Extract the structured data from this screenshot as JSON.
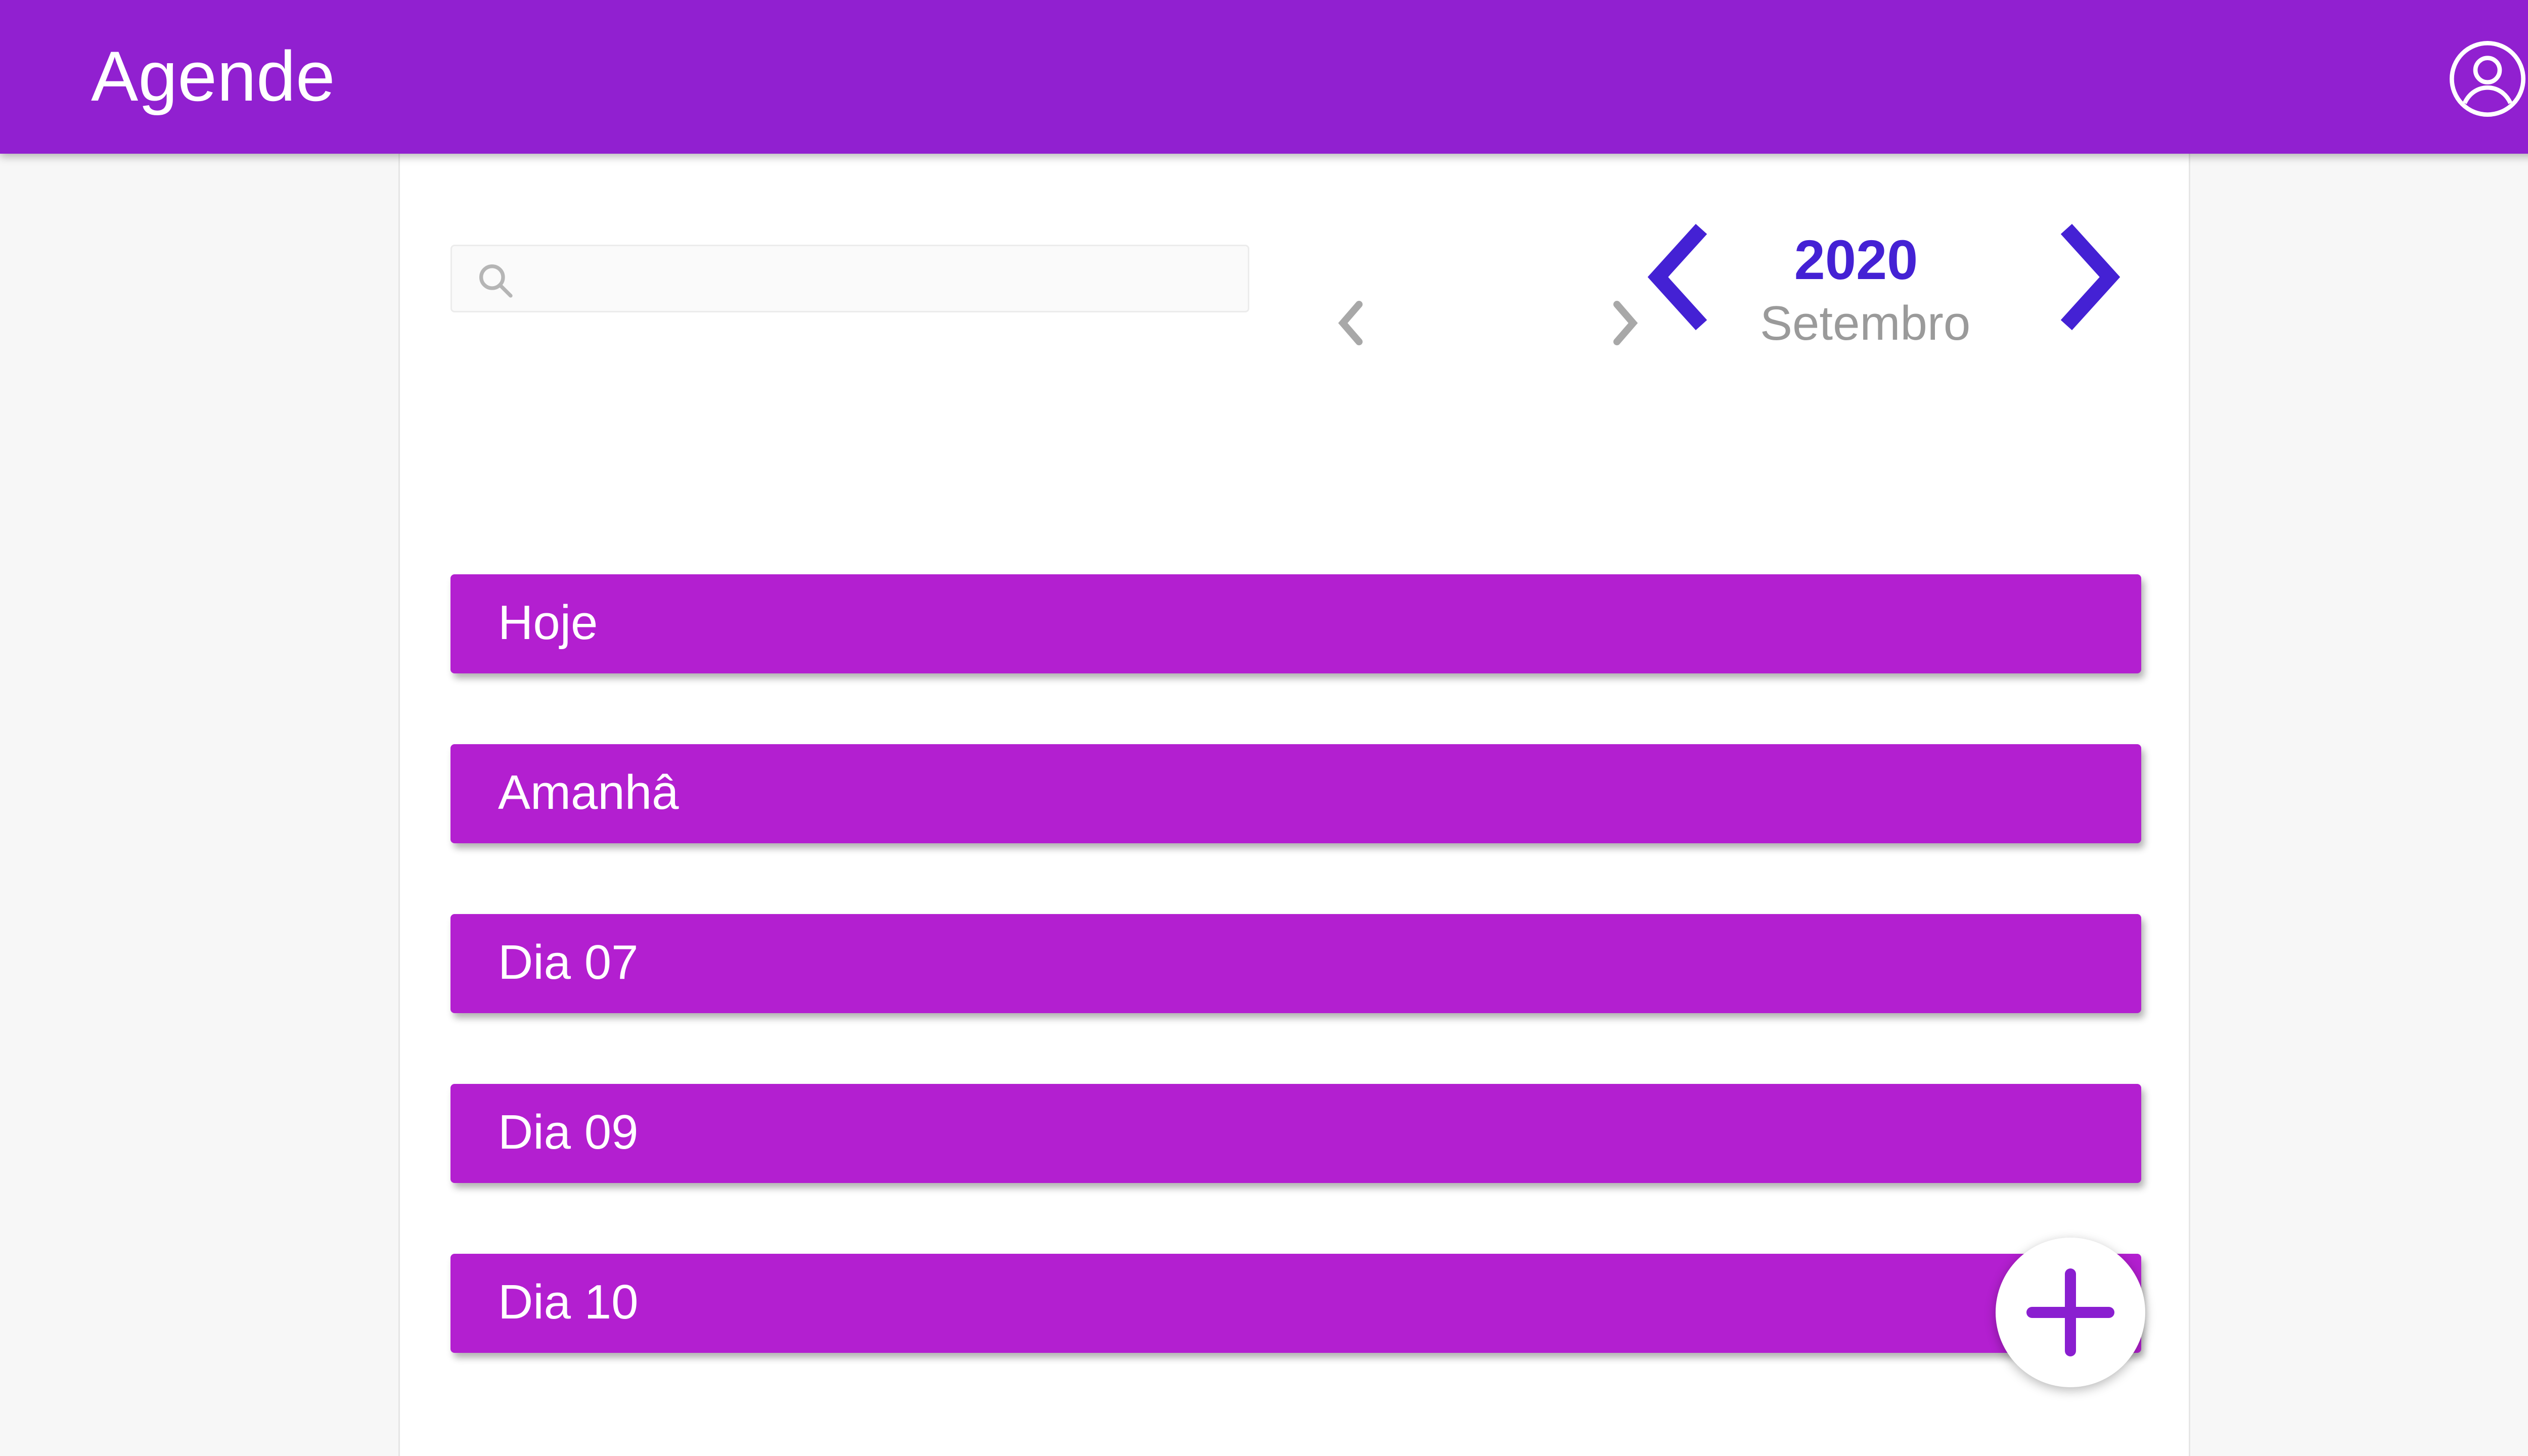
{
  "app": {
    "title": "Agende"
  },
  "header": {
    "account_icon": "account-circle-icon"
  },
  "search": {
    "placeholder": "",
    "value": "",
    "icon": "search-icon"
  },
  "calendar_nav": {
    "year": "2020",
    "month": "Setembro",
    "prev_year_icon": "chevron-left-icon",
    "next_year_icon": "chevron-right-icon",
    "prev_month_icon": "chevron-left-icon",
    "next_month_icon": "chevron-right-icon"
  },
  "days": [
    {
      "label": "Hoje"
    },
    {
      "label": "Amanhâ"
    },
    {
      "label": "Dia 07"
    },
    {
      "label": "Dia 09"
    },
    {
      "label": "Dia 10"
    }
  ],
  "fab": {
    "icon": "plus-icon"
  },
  "colors": {
    "appbar": "#9120d0",
    "day_item": "#b31fd0",
    "accent": "#4421d4",
    "month_text": "#9a9a9a",
    "background": "#f7f7f7"
  }
}
